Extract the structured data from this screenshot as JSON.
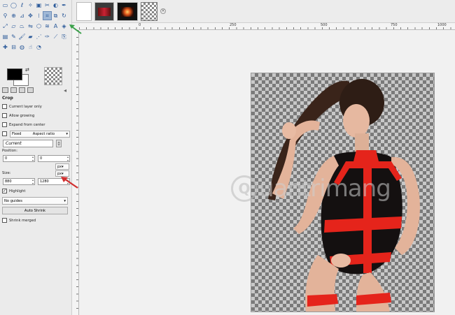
{
  "toolbox": {
    "tool_icons": [
      "rect-select-icon",
      "ellipse-select-icon",
      "free-select-icon",
      "fuzzy-select-icon",
      "by-color-select-icon",
      "scissors-icon",
      "foreground-select-icon",
      "paths-icon",
      "color-picker-icon",
      "zoom-icon",
      "measure-icon",
      "move-icon",
      "align-icon",
      "crop-icon",
      "unified-transform-icon",
      "rotate-icon",
      "scale-icon",
      "shear-icon",
      "perspective-icon",
      "flip-icon",
      "cage-icon",
      "warp-icon",
      "text-icon",
      "bucket-fill-icon",
      "gradient-icon",
      "pencil-icon",
      "paintbrush-icon",
      "eraser-icon",
      "airbrush-icon",
      "ink-icon",
      "mypaint-icon",
      "clone-icon",
      "heal-icon",
      "perspective-clone-icon",
      "blur-icon",
      "smudge-icon",
      "dodge-burn-icon"
    ],
    "active_tool": "crop-icon",
    "foreground_color": "#000000",
    "background_color": "#ffffff"
  },
  "tool_options": {
    "title": "Crop",
    "current_layer_only": "Current layer only",
    "allow_growing": "Allow growing",
    "expand_from_center": "Expand from center",
    "fixed_label": "Fixed",
    "fixed_value": "Aspect ratio",
    "current_value": "Current",
    "position_label": "Position:",
    "position_unit": "px",
    "position_x": "0",
    "position_y": "0",
    "size_label": "Size:",
    "size_unit": "px",
    "size_w": "880",
    "size_h": "1280",
    "highlight_label": "Highlight",
    "highlight_checked": "✓",
    "guides_value": "No guides",
    "auto_shrink_label": "Auto Shrink",
    "shrink_merged_label": "Shrink merged"
  },
  "ruler": {
    "labels": [
      "0",
      "250",
      "500",
      "750",
      "1000"
    ]
  },
  "watermark": {
    "text": "uantrimang"
  },
  "colors": {
    "annotation_arrow": "#d23030",
    "annotation_arrow_green": "#3aa14a"
  }
}
